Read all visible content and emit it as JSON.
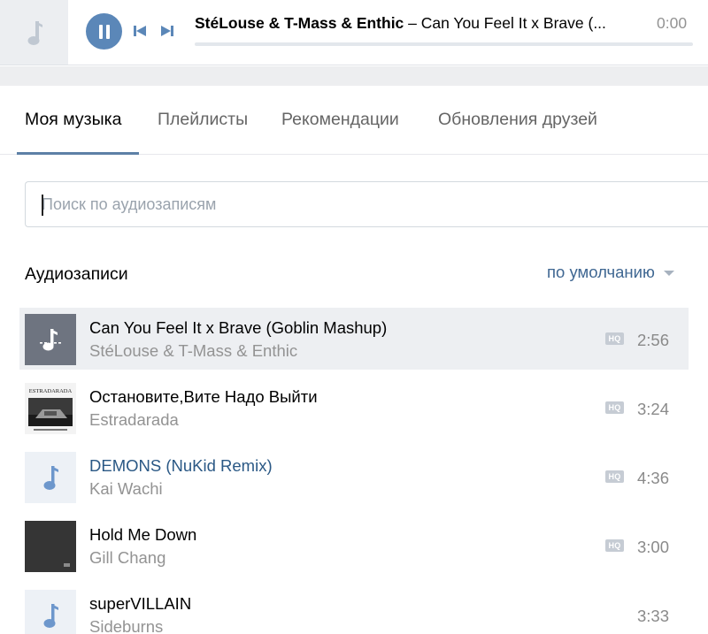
{
  "player": {
    "artist": "StéLouse & T-Mass & Enthic",
    "separator": " – ",
    "title": "Can You Feel It x Brave (...",
    "time": "0:00",
    "progress": 0
  },
  "tabs": [
    {
      "label": "Моя музыка",
      "active": true
    },
    {
      "label": "Плейлисты",
      "active": false
    },
    {
      "label": "Рекомендации",
      "active": false
    },
    {
      "label": "Обновления друзей",
      "active": false
    }
  ],
  "search": {
    "placeholder": "Поиск по аудиозаписям",
    "value": ""
  },
  "list": {
    "title": "Аудиозаписи",
    "sort_label": "по умолчанию"
  },
  "tracks": [
    {
      "title": "Can You Feel It x Brave (Goblin Mashup)",
      "artist": "StéLouse & T-Mass & Enthic",
      "hq": "HQ",
      "duration": "2:56",
      "cover": "now-playing-icon",
      "current": true
    },
    {
      "title": "Остановите,Вите Надо Выйти",
      "artist": "Estradarada",
      "hq": "HQ",
      "duration": "3:24",
      "cover": "album-cover-estradarada",
      "cover_text": "ESTRADARADA"
    },
    {
      "title": "DEMONS (NuKid Remix)",
      "artist": "Kai Wachi",
      "hq": "HQ",
      "duration": "4:36",
      "cover": "music-note-icon"
    },
    {
      "title": "Hold Me Down",
      "artist": "Gill Chang",
      "hq": "HQ",
      "duration": "3:00",
      "cover": "album-cover-dark"
    },
    {
      "title": "superVILLAIN",
      "artist": "Sideburns",
      "duration": "3:33",
      "cover": "music-note-icon"
    }
  ],
  "colors": {
    "accent": "#5b87b8",
    "link": "#2a5885",
    "muted": "#939393",
    "tab_underline": "#5d80a6"
  }
}
